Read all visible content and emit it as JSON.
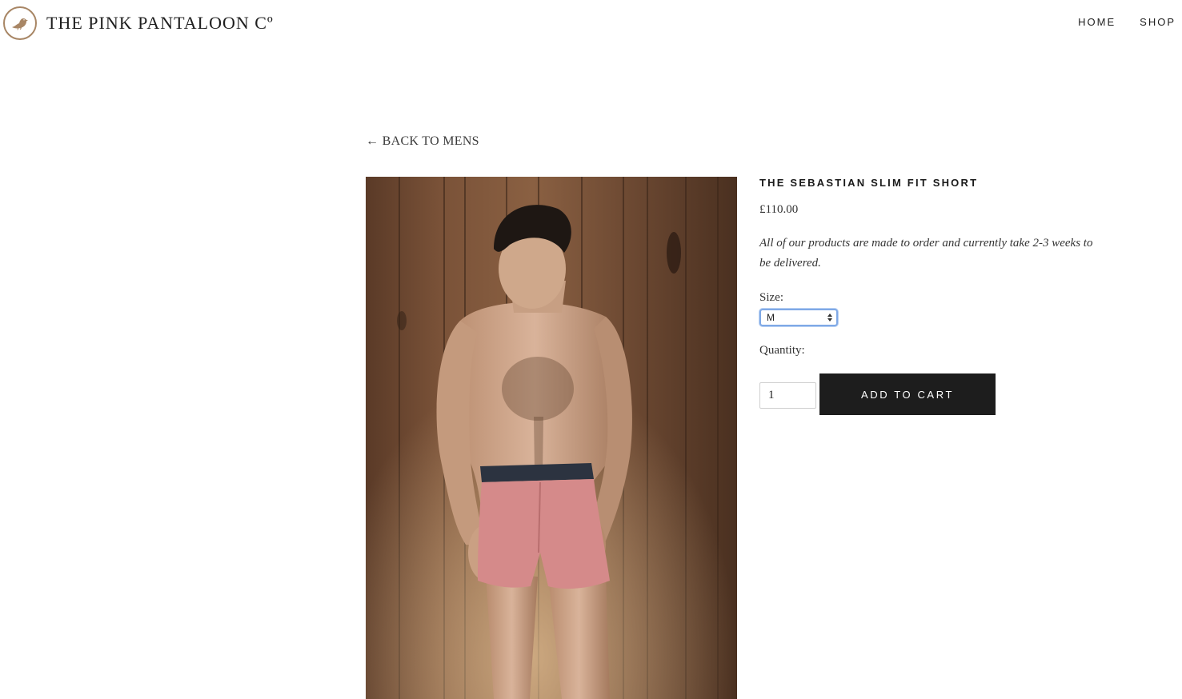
{
  "brand": {
    "name": "THE PINK PANTALOON Cº",
    "logo_icon": "bird-icon",
    "logo_color": "#a88665"
  },
  "nav": {
    "items": [
      {
        "label": "HOME"
      },
      {
        "label": "SHOP"
      }
    ]
  },
  "back_link": {
    "arrow": "←",
    "label": "BACK TO MENS"
  },
  "product": {
    "title": "THE SEBASTIAN SLIM FIT SHORT",
    "price": "£110.00",
    "note": "All of our products are made to order and currently take 2-3 weeks to be delivered.",
    "size_label": "Size:",
    "size_value": "M",
    "quantity_label": "Quantity:",
    "quantity_value": "1",
    "add_to_cart": "ADD TO CART",
    "button_color": "#1d1d1d"
  }
}
